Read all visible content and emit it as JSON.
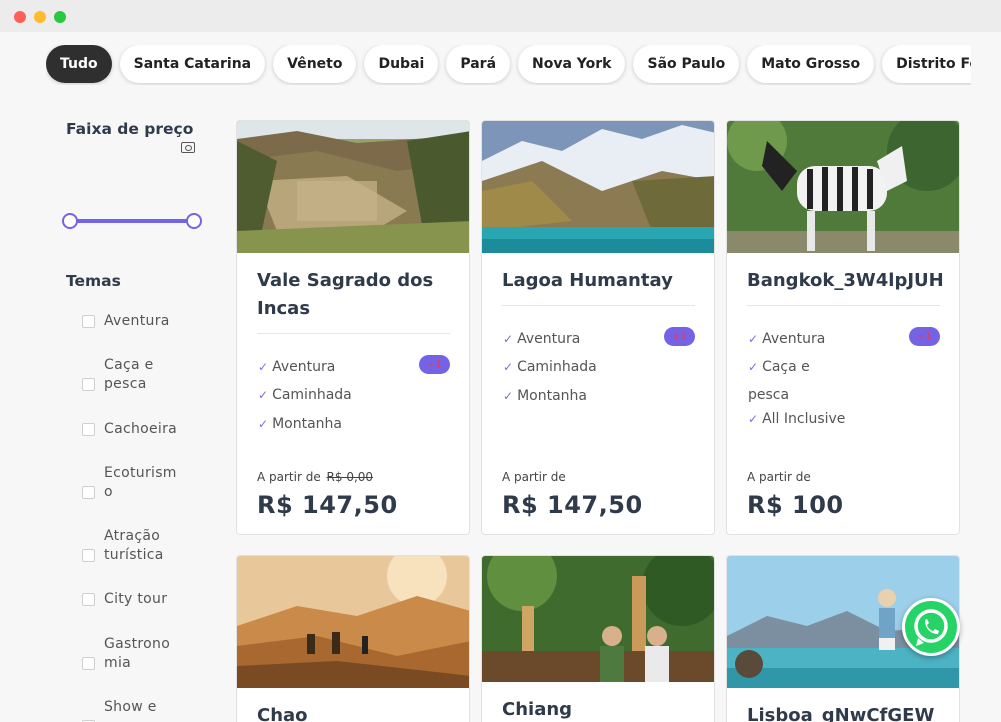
{
  "filters": {
    "chips": [
      {
        "label": "Tudo",
        "active": true
      },
      {
        "label": "Santa Catarina",
        "active": false
      },
      {
        "label": "Vêneto",
        "active": false
      },
      {
        "label": "Dubai",
        "active": false
      },
      {
        "label": "Pará",
        "active": false
      },
      {
        "label": "Nova York",
        "active": false
      },
      {
        "label": "São Paulo",
        "active": false
      },
      {
        "label": "Mato Grosso",
        "active": false
      },
      {
        "label": "Distrito Federal",
        "active": false
      }
    ]
  },
  "sidebar": {
    "price_title": "Faixa de preço",
    "themes_title": "Temas",
    "themes": [
      {
        "label": "Aventura"
      },
      {
        "label": "Caça e pesca"
      },
      {
        "label": "Cachoeira"
      },
      {
        "label": "Ecoturismo"
      },
      {
        "label": "Atração turística"
      },
      {
        "label": "City tour"
      },
      {
        "label": "Gastronomia"
      },
      {
        "label": "Show e"
      }
    ]
  },
  "cards": [
    {
      "title": "Vale Sagrado dos Incas",
      "features": [
        "Aventura",
        "Caminhada",
        "Montanha"
      ],
      "badge": "+1",
      "from_label": "A partir de",
      "old_price": "R$ 0,00",
      "price": "R$ 147,50"
    },
    {
      "title": "Lagoa Humantay",
      "features": [
        "Aventura",
        "Caminhada",
        "Montanha"
      ],
      "badge": "+1",
      "from_label": "A partir de",
      "price": "R$ 147,50"
    },
    {
      "title": "Bangkok_3W4lpJUH",
      "features": [
        "Aventura",
        "Caça e pesca",
        "All Inclusive"
      ],
      "badge": "+1",
      "from_label": "A partir de",
      "price": "R$ 100"
    },
    {
      "title": "Chao"
    },
    {
      "title": "Chiang"
    },
    {
      "title": "Lisboa_gNwCfGEW"
    }
  ],
  "colors": {
    "accent": "#7563e6",
    "active_chip": "#2f2f2f",
    "whatsapp": "#25d366"
  },
  "icons": {
    "whatsapp": "whatsapp-icon",
    "money": "money-icon",
    "check": "check-icon"
  }
}
